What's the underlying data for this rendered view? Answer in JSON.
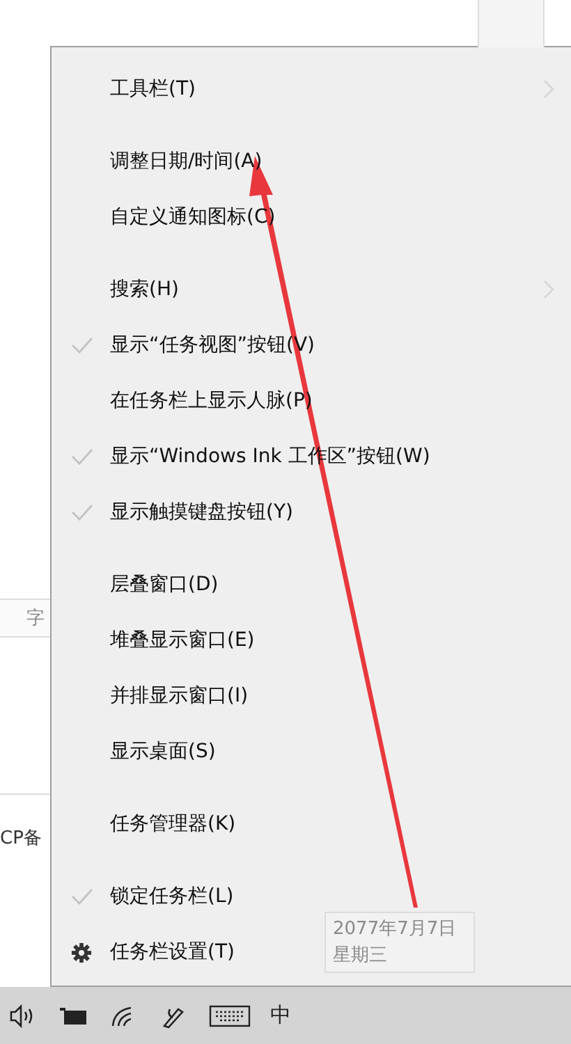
{
  "background_page": {
    "tab_label": "字",
    "footer_text": "CP备"
  },
  "context_menu": {
    "groups": [
      [
        {
          "label": "工具栏(T)",
          "kind": "submenu"
        }
      ],
      [
        {
          "label": "调整日期/时间(A)",
          "kind": "plain"
        },
        {
          "label": "自定义通知图标(C)",
          "kind": "plain"
        }
      ],
      [
        {
          "label": "搜索(H)",
          "kind": "submenu"
        },
        {
          "label": "显示“任务视图”按钮(V)",
          "kind": "check",
          "checked": true
        },
        {
          "label": "在任务栏上显示人脉(P)",
          "kind": "check",
          "checked": false
        },
        {
          "label": "显示“Windows Ink 工作区”按钮(W)",
          "kind": "check",
          "checked": true
        },
        {
          "label": "显示触摸键盘按钮(Y)",
          "kind": "check",
          "checked": true
        }
      ],
      [
        {
          "label": "层叠窗口(D)",
          "kind": "plain"
        },
        {
          "label": "堆叠显示窗口(E)",
          "kind": "plain"
        },
        {
          "label": "并排显示窗口(I)",
          "kind": "plain"
        },
        {
          "label": "显示桌面(S)",
          "kind": "plain"
        }
      ],
      [
        {
          "label": "任务管理器(K)",
          "kind": "plain"
        }
      ],
      [
        {
          "label": "锁定任务栏(L)",
          "kind": "check",
          "checked": true
        },
        {
          "label": "任务栏设置(T)",
          "kind": "settings"
        }
      ]
    ]
  },
  "tooltip": {
    "lines": [
      "2077年7月7日",
      "星期三"
    ]
  },
  "taskbar": {
    "input_method": "中"
  }
}
